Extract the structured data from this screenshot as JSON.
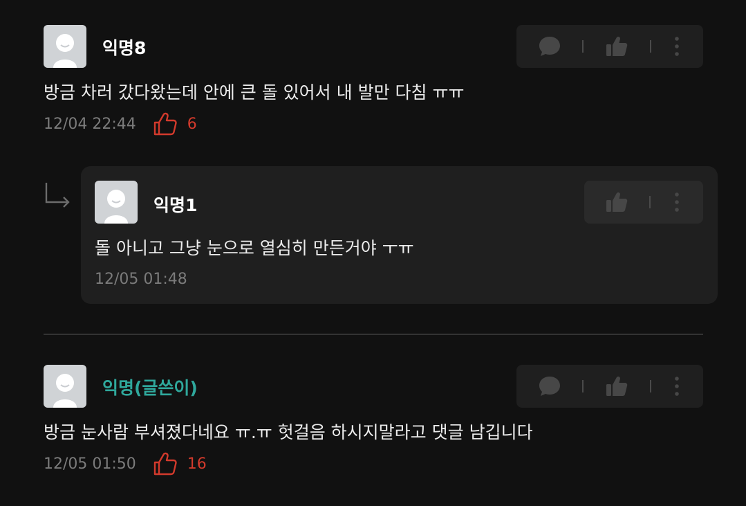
{
  "comments": [
    {
      "author": "익명8",
      "text": "방금 차러 갔다왔는데 안에 큰 돌 있어서 내 발만 다침 ㅠㅠ",
      "date": "12/04 22:44",
      "likes": "6"
    },
    {
      "author": "익명(글쓴이)",
      "text": "방금 눈사람 부셔졌다네요 ㅠ.ㅠ 헛걸음 하시지말라고 댓글 남깁니다",
      "date": "12/05 01:50",
      "likes": "16"
    }
  ],
  "reply": {
    "author": "익명1",
    "text": "돌 아니고 그냥 눈으로 열심히 만든거야 ㅜㅠ",
    "date": "12/05 01:48"
  },
  "colors": {
    "background": "#111111",
    "card": "#1f1f1f",
    "op_author": "#2fa89c",
    "like_accent": "#d33a2c",
    "meta_text": "#7b7b7b"
  },
  "icons": [
    "avatar-placeholder",
    "chat-bubble-icon",
    "thumbs-up-icon",
    "more-vertical-icon",
    "reply-arrow-icon",
    "thumbs-up-outline-icon"
  ]
}
